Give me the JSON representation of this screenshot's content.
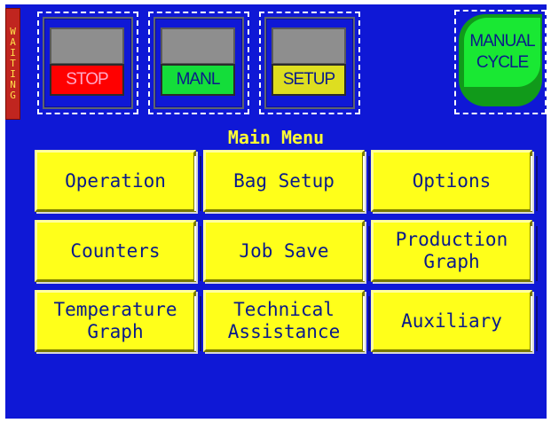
{
  "status_strip": {
    "text": "WAITING",
    "letters": [
      "W",
      "A",
      "I",
      "T",
      "I",
      "N",
      "G"
    ]
  },
  "indicators": [
    {
      "label": "STOP",
      "color": "red"
    },
    {
      "label": "MANL",
      "color": "green"
    },
    {
      "label": "SETUP",
      "color": "yellow"
    }
  ],
  "manual_cycle": {
    "line1": "MANUAL",
    "line2": "CYCLE"
  },
  "menu": {
    "title": "Main Menu",
    "buttons": [
      {
        "label": "Operation"
      },
      {
        "label": "Bag Setup"
      },
      {
        "label": "Options"
      },
      {
        "label": "Counters"
      },
      {
        "label": "Job Save"
      },
      {
        "label": "Production\nGraph"
      },
      {
        "label": "Temperature\nGraph"
      },
      {
        "label": "Technical\nAssistance"
      },
      {
        "label": "Auxiliary"
      }
    ]
  },
  "colors": {
    "background": "#0f18d6",
    "button": "#ffff1a",
    "title": "#ffff33",
    "stop": "#ff0000",
    "manual": "#14dd3a",
    "setup": "#dede20"
  }
}
